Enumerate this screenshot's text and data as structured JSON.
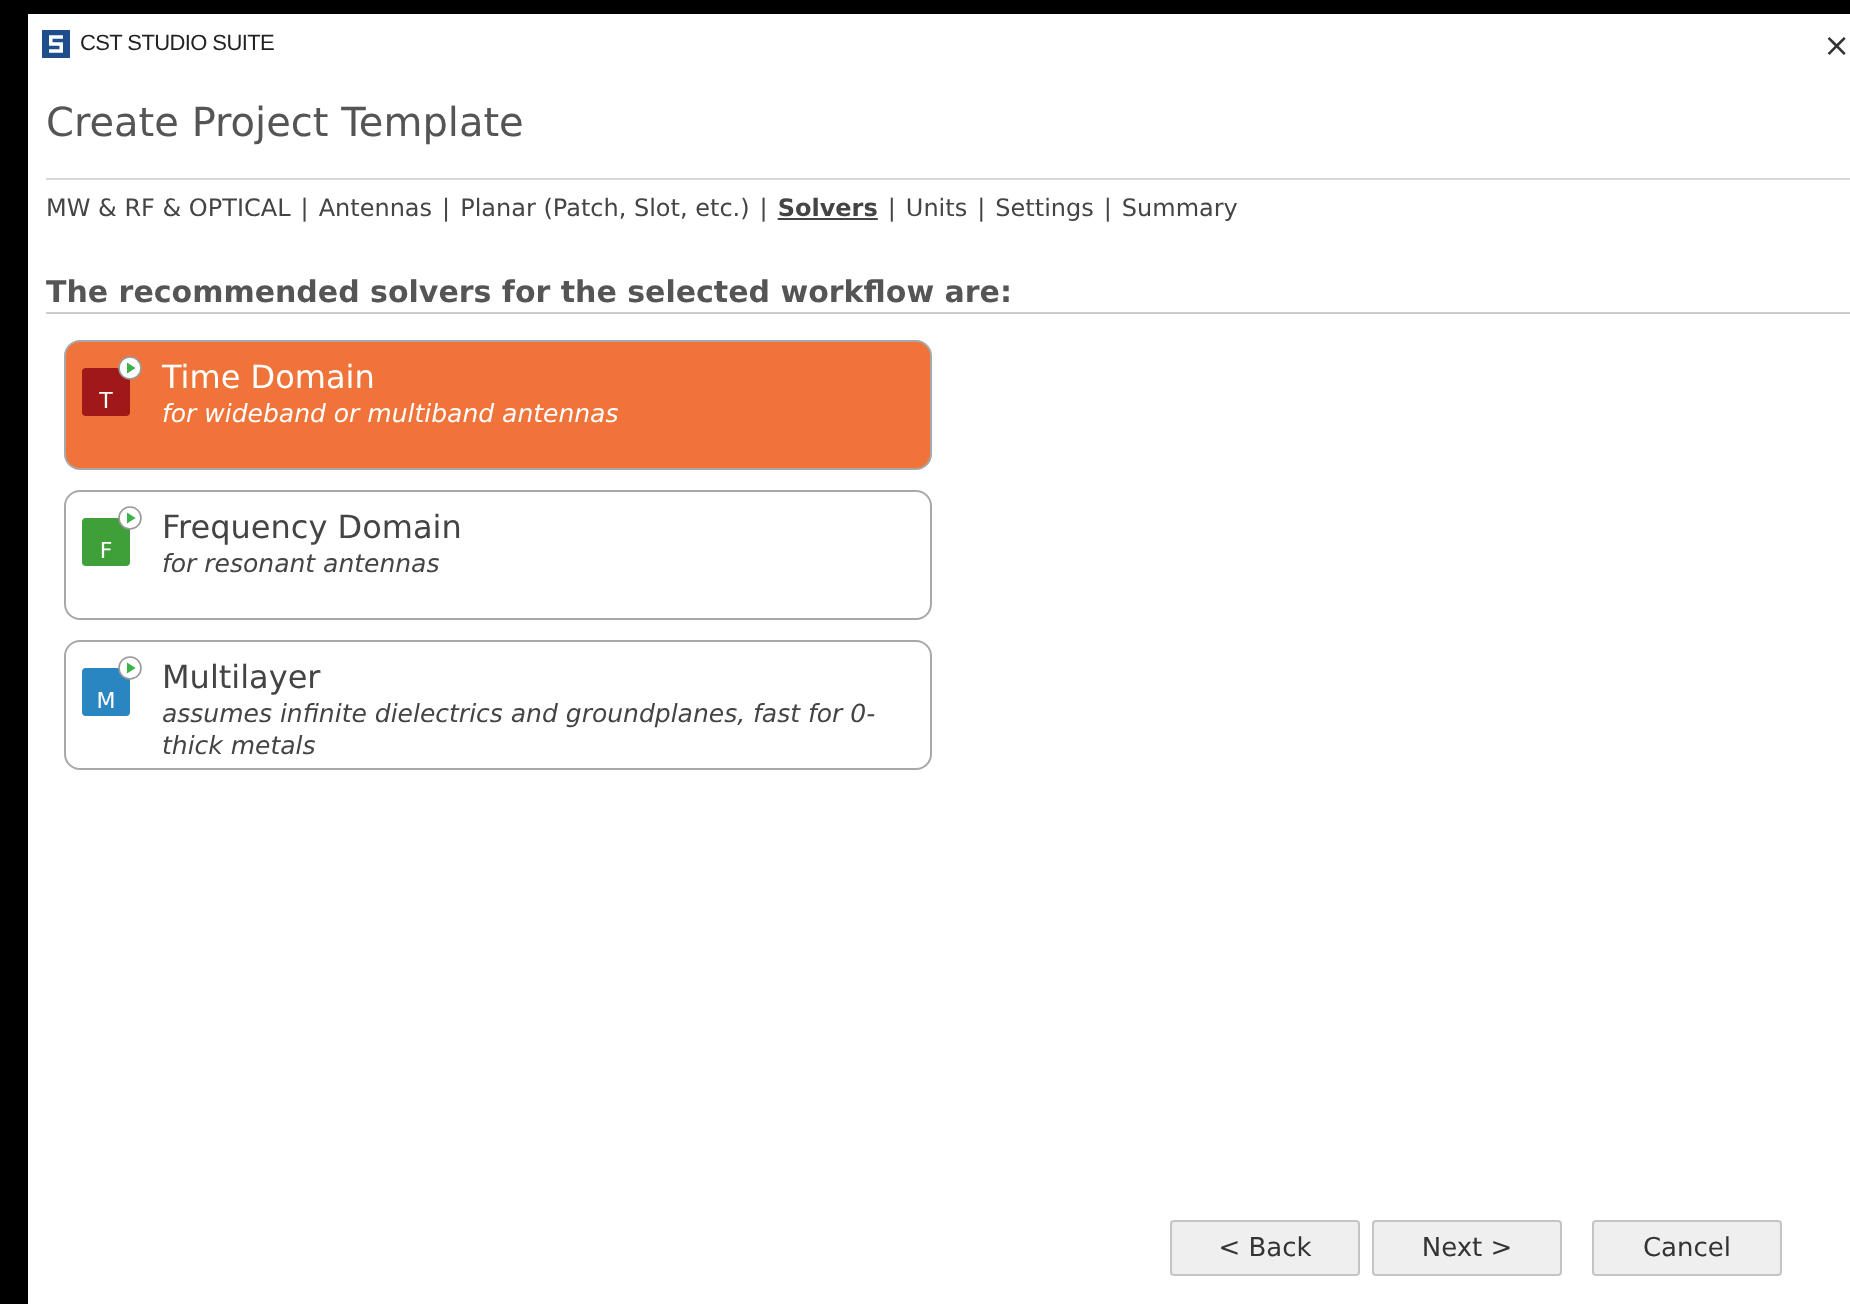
{
  "window": {
    "title": "CST STUDIO SUITE",
    "close": "×"
  },
  "heading": "Create Project Template",
  "breadcrumb": {
    "separator": "|",
    "items": [
      {
        "label": "MW & RF & OPTICAL",
        "selected": false
      },
      {
        "label": "Antennas",
        "selected": false
      },
      {
        "label": "Planar (Patch, Slot, etc.)",
        "selected": false
      },
      {
        "label": "Solvers",
        "selected": true
      },
      {
        "label": "Units",
        "selected": false
      },
      {
        "label": "Settings",
        "selected": false
      },
      {
        "label": "Summary",
        "selected": false
      }
    ]
  },
  "section_title": "The recommended solvers for the selected workflow are:",
  "solvers": [
    {
      "letter": "T",
      "color": "#a01818",
      "title": "Time Domain",
      "description": "for wideband or multiband antennas",
      "selected": true
    },
    {
      "letter": "F",
      "color": "#3fa03a",
      "title": "Frequency Domain",
      "description": "for resonant antennas",
      "selected": false
    },
    {
      "letter": "M",
      "color": "#2a86c0",
      "title": "Multilayer",
      "description": "assumes infinite dielectrics and groundplanes, fast for 0-thick metals",
      "selected": false
    }
  ],
  "buttons": [
    "< Back",
    "Next >",
    "Cancel"
  ]
}
